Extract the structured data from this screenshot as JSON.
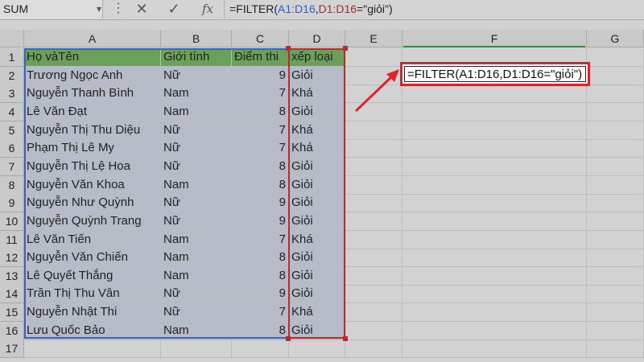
{
  "namebox": {
    "value": "SUM"
  },
  "formula_bar": {
    "prefix": "=FILTER(",
    "ref1": "A1:D16",
    "comma1": ",",
    "ref2": "D1:D16",
    "suffix": "=\"giỏi\")"
  },
  "columns": [
    "A",
    "B",
    "C",
    "D",
    "E",
    "F",
    "G"
  ],
  "rows": [
    "1",
    "2",
    "3",
    "4",
    "5",
    "6",
    "7",
    "8",
    "9",
    "10",
    "11",
    "12",
    "13",
    "14",
    "15",
    "16",
    "17"
  ],
  "table": {
    "headers": [
      "Họ vàTên",
      "Giới tính",
      "Điểm thi",
      "xếp loại"
    ],
    "records": [
      [
        "Trương Ngọc Anh",
        "Nữ",
        "9",
        "Giỏi"
      ],
      [
        "Nguyễn Thanh Bình",
        "Nam",
        "7",
        "Khá"
      ],
      [
        "Lê Văn Đạt",
        "Nam",
        "8",
        "Giỏi"
      ],
      [
        "Nguyễn Thị Thu Diệu",
        "Nữ",
        "7",
        "Khá"
      ],
      [
        "Phạm Thị Lê My",
        "Nữ",
        "7",
        "Khá"
      ],
      [
        "Nguyễn Thị Lệ Hoa",
        "Nữ",
        "8",
        "Giỏi"
      ],
      [
        "Nguyễn Văn Khoa",
        "Nam",
        "8",
        "Giỏi"
      ],
      [
        "Nguyễn Như Quỳnh",
        "Nữ",
        "9",
        "Giỏi"
      ],
      [
        "Nguyễn Quỳnh Trang",
        "Nữ",
        "9",
        "Giỏi"
      ],
      [
        "Lê Văn Tiến",
        "Nam",
        "7",
        "Khá"
      ],
      [
        "Nguyễn Văn Chiến",
        "Nam",
        "8",
        "Giỏi"
      ],
      [
        "Lê Quyết Thắng",
        "Nam",
        "8",
        "Giỏi"
      ],
      [
        "Trần Thị Thu Vân",
        "Nữ",
        "9",
        "Giỏi"
      ],
      [
        "Nguyễn Nhật Thi",
        "Nữ",
        "7",
        "Khá"
      ],
      [
        "Lưu Quốc Bảo",
        "Nam",
        "8",
        "Giỏi"
      ]
    ]
  },
  "callout_formula": "=FILTER(A1:D16,D1:D16=\"giỏi\")",
  "colors": {
    "header_fill": "#6ba05a",
    "callout_border": "#d4262d",
    "arrow": "#e0242b"
  }
}
